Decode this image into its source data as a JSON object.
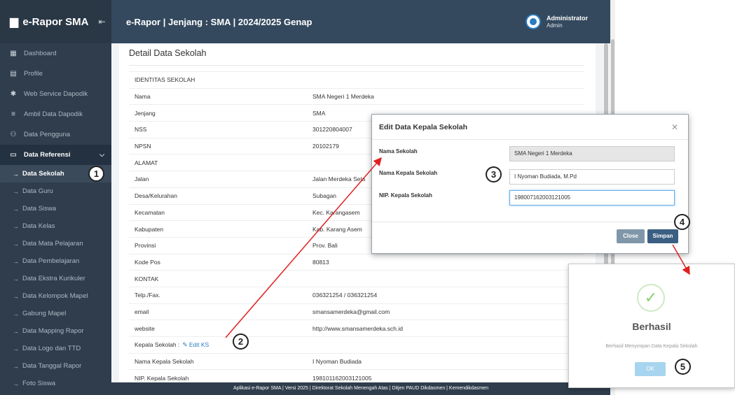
{
  "sidebar": {
    "app_name": "e-Rapor SMA",
    "items": [
      {
        "label": "Dashboard",
        "icon": "dashboard-icon",
        "glyph": "▦"
      },
      {
        "label": "Profile",
        "icon": "profile-icon",
        "glyph": "▤"
      },
      {
        "label": "Web Service Dapodik",
        "icon": "gear-icon",
        "glyph": "✱"
      },
      {
        "label": "Ambil Data Dapodik",
        "icon": "database-icon",
        "glyph": "≡"
      },
      {
        "label": "Data Pengguna",
        "icon": "users-icon",
        "glyph": "⚇"
      }
    ],
    "group": {
      "label": "Data Referensi",
      "icon": "monitor-icon",
      "glyph": "▭"
    },
    "sub_items": [
      "Data Sekolah",
      "Data Guru",
      "Data Siswa",
      "Data Kelas",
      "Data Mata Pelajaran",
      "Data Pembelajaran",
      "Data Ekstra Kurikuler",
      "Data Kelompok Mapel",
      "Gabung Mapel",
      "Data Mapping Rapor",
      "Data Logo dan TTD",
      "Data Tanggal Rapor",
      "Foto Siswa"
    ]
  },
  "header": {
    "title": "e-Rapor | Jenjang : SMA | 2024/2025 Genap",
    "user_name": "Administrator",
    "user_role": "Admin"
  },
  "card": {
    "title": "Detail Data Sekolah",
    "rows": [
      {
        "label": "IDENTITAS SEKOLAH",
        "value": "",
        "section": true
      },
      {
        "label": "Nama",
        "value": "SMA Negeri 1 Merdeka"
      },
      {
        "label": "Jenjang",
        "value": "SMA"
      },
      {
        "label": "NSS",
        "value": "301220804007"
      },
      {
        "label": "NPSN",
        "value": "20102179"
      },
      {
        "label": "ALAMAT",
        "value": "",
        "section": true
      },
      {
        "label": "Jalan",
        "value": "Jalan Merdeka Sela"
      },
      {
        "label": "Desa/Kelurahan",
        "value": "Subagan"
      },
      {
        "label": "Kecamatan",
        "value": "Kec. Karangasem"
      },
      {
        "label": "Kabupaten",
        "value": "Kab. Karang Asem"
      },
      {
        "label": "Provinsi",
        "value": "Prov. Bali"
      },
      {
        "label": "Kode Pos",
        "value": "80813"
      },
      {
        "label": "KONTAK",
        "value": "",
        "section": true
      },
      {
        "label": "Telp./Fax.",
        "value": "036321254 / 036321254"
      },
      {
        "label": "email",
        "value": "smansamerdeka@gmail.com"
      },
      {
        "label": "website",
        "value": "http://www.smansamerdeka.sch.id"
      },
      {
        "label": "Kepala Sekolah :",
        "value": "",
        "edit": true
      },
      {
        "label": "Nama Kepala Sekolah",
        "value": "I Nyoman Budiada"
      },
      {
        "label": "NIP. Kepala Sekolah",
        "value": "198101162003121005"
      }
    ],
    "edit_ks_label": "Edit KS"
  },
  "footer": {
    "text": "Aplikasi e-Rapor SMA | Versi 2025 | Direktorat Sekolah Menengah Atas | Ditjen PAUD Dikdasmen | Kemendikdasmen"
  },
  "modal": {
    "title": "Edit Data Kepala Sekolah",
    "fields": [
      {
        "label": "Nama Sekolah",
        "value": "SMA Negeri 1 Merdeka"
      },
      {
        "label": "Nama Kepala Sekolah",
        "value": "I Nyoman Budiada, M.Pd"
      },
      {
        "label": "NIP. Kepala Sekolah",
        "value": "198007162003121005"
      }
    ],
    "close_label": "Close",
    "save_label": "Simpan"
  },
  "success": {
    "title": "Berhasil",
    "message": "Berhasil Menyimpan Data Kepala Sekolah",
    "ok_label": "OK"
  },
  "callouts": [
    "1",
    "2",
    "3",
    "4",
    "5"
  ],
  "colors": {
    "sidebar": "#2f3d4d",
    "header": "#34495e",
    "accent": "#2a7cc1",
    "arrow": "#e02020"
  }
}
